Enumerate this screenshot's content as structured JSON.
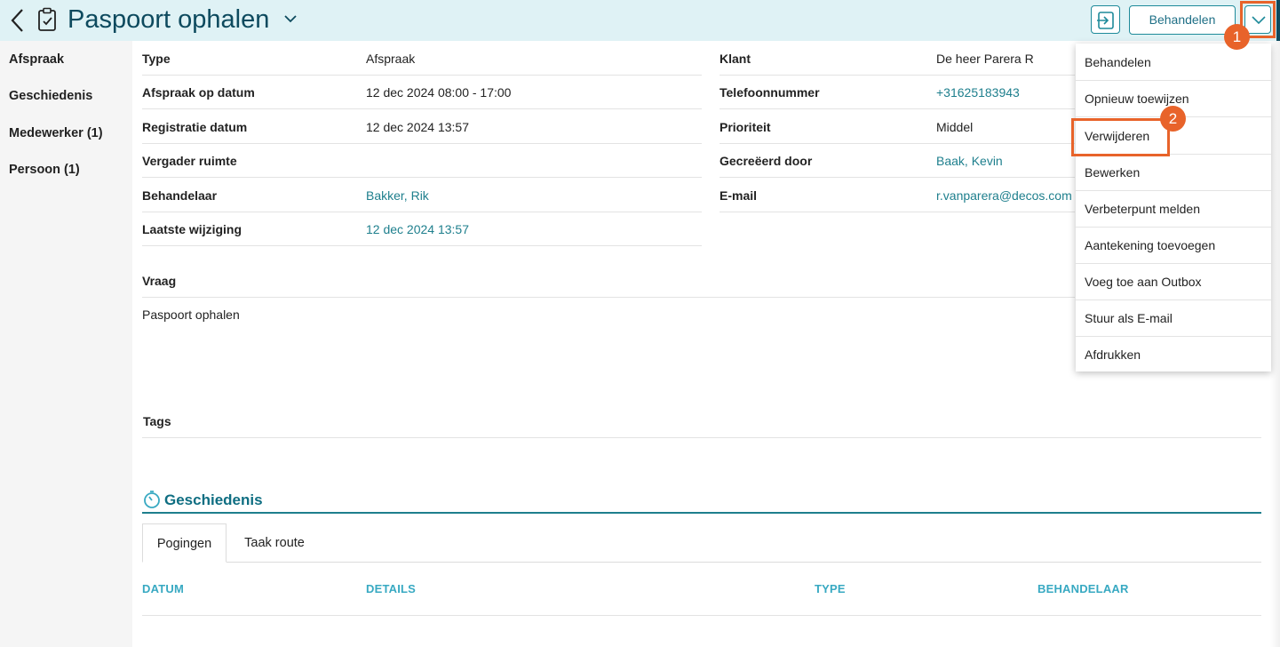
{
  "header": {
    "title": "Paspoort ophalen",
    "behandelen_label": "Behandelen"
  },
  "sidebar": {
    "items": [
      {
        "label": "Afspraak"
      },
      {
        "label": "Geschiedenis"
      },
      {
        "label": "Medewerker (1)"
      },
      {
        "label": "Persoon (1)"
      }
    ]
  },
  "details_left": [
    {
      "label": "Type",
      "value": "Afspraak"
    },
    {
      "label": "Afspraak op datum",
      "value": "12 dec 2024 08:00 - 17:00"
    },
    {
      "label": "Registratie datum",
      "value": "12 dec 2024 13:57"
    },
    {
      "label": "Vergader ruimte",
      "value": ""
    },
    {
      "label": "Behandelaar",
      "value": "Bakker, Rik"
    },
    {
      "label": "Laatste wijziging",
      "value": "12 dec 2024 13:57"
    }
  ],
  "details_right": [
    {
      "label": "Klant",
      "value": "De heer Parera R"
    },
    {
      "label": "Telefoonnummer",
      "value": "+31625183943"
    },
    {
      "label": "Prioriteit",
      "value": "Middel"
    },
    {
      "label": "Gecreëerd door",
      "value": "Baak, Kevin"
    },
    {
      "label": "E-mail",
      "value": "r.vanparera@decos.com"
    }
  ],
  "vraag": {
    "label": "Vraag",
    "value": "Paspoort ophalen"
  },
  "tags": {
    "label": "Tags"
  },
  "geschiedenis": {
    "title": "Geschiedenis",
    "tabs": [
      {
        "label": "Pogingen"
      },
      {
        "label": "Taak route"
      }
    ],
    "columns": [
      "DATUM",
      "DETAILS",
      "TYPE",
      "BEHANDELAAR"
    ]
  },
  "dropdown": {
    "items": [
      {
        "label": "Behandelen"
      },
      {
        "label": "Opnieuw toewijzen"
      },
      {
        "label": "Verwijderen"
      },
      {
        "label": "Bewerken"
      },
      {
        "label": "Verbeterpunt melden"
      },
      {
        "label": "Aantekening toevoegen"
      },
      {
        "label": "Voeg toe aan Outbox"
      },
      {
        "label": "Stuur als E-mail"
      },
      {
        "label": "Afdrukken"
      }
    ]
  },
  "annotations": {
    "step1": "1",
    "step2": "2"
  },
  "colors": {
    "accent": "#1e7f8d",
    "header_bg": "#dff2f5",
    "highlight": "#e8632a",
    "table_header": "#38a9c2"
  }
}
